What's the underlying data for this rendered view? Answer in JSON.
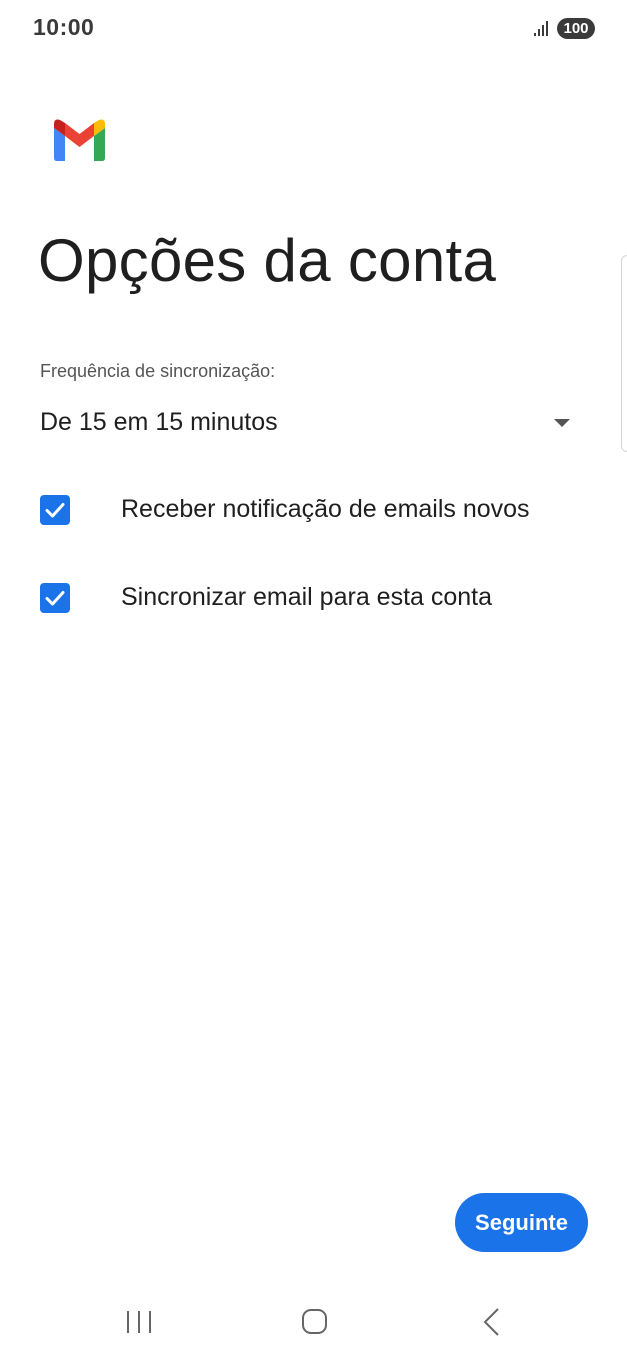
{
  "status_bar": {
    "time": "10:00",
    "battery": "100",
    "signal_icon": "signal-bars-icon"
  },
  "app": {
    "logo": "gmail-logo"
  },
  "page": {
    "title": "Opções da conta"
  },
  "sync": {
    "label": "Frequência de sincronização:",
    "selected": "De 15 em 15 minutos",
    "icon": "dropdown-arrow-icon"
  },
  "options": [
    {
      "label": "Receber notificação de emails novos",
      "checked": true
    },
    {
      "label": "Sincronizar email para esta conta",
      "checked": true
    }
  ],
  "actions": {
    "next_label": "Seguinte"
  },
  "nav_bar": {
    "recents_icon": "recent-apps-icon",
    "home_icon": "home-icon",
    "back_icon": "back-icon"
  },
  "colors": {
    "accent": "#1a73e8",
    "text": "#1f1f1f",
    "secondary_text": "#555555"
  }
}
